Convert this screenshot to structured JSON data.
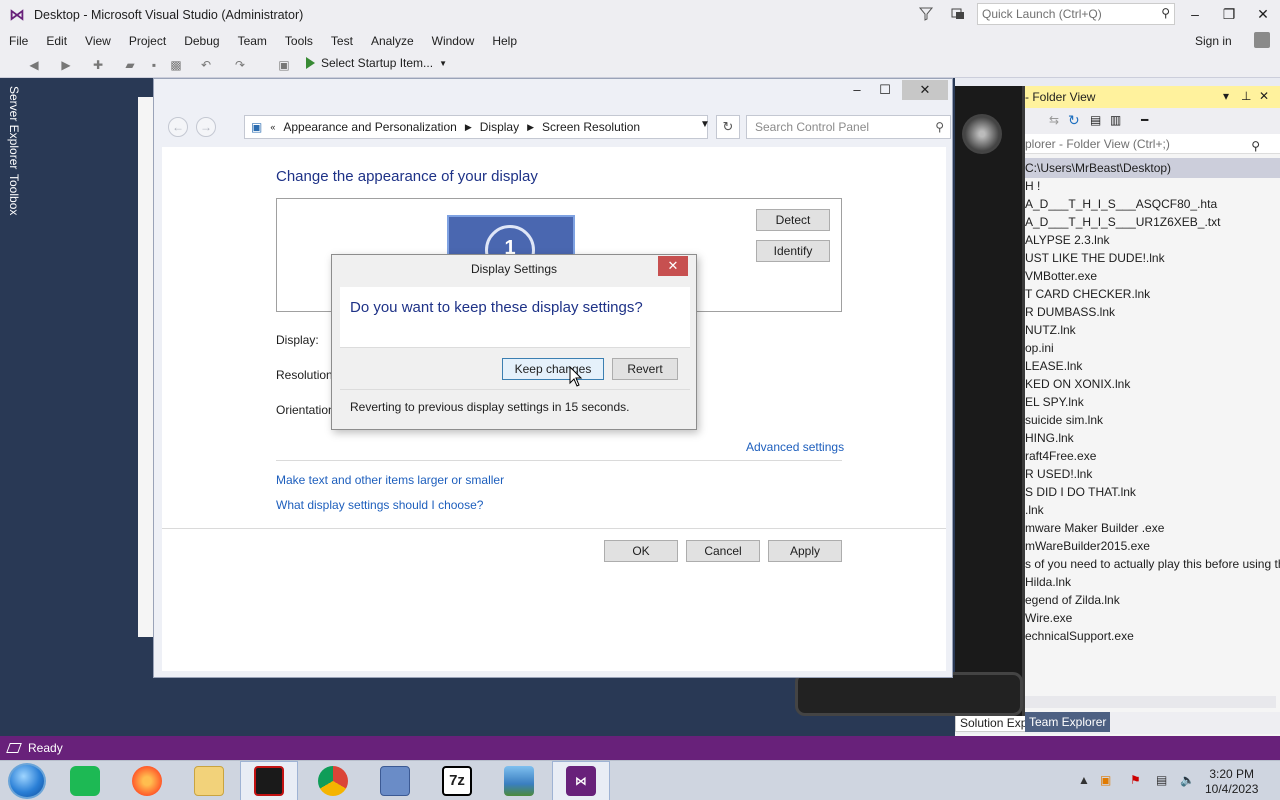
{
  "vs": {
    "title": "Desktop - Microsoft Visual Studio  (Administrator)",
    "quick_launch_placeholder": "Quick Launch (Ctrl+Q)",
    "menu": [
      "File",
      "Edit",
      "View",
      "Project",
      "Debug",
      "Team",
      "Tools",
      "Test",
      "Analyze",
      "Window",
      "Help"
    ],
    "sign_in": "Sign in",
    "start_item": "Select Startup Item...",
    "side_tabs": [
      "Server Explorer",
      "Toolbox"
    ],
    "status": "Ready",
    "brand_color": "#68217a"
  },
  "solution_explorer": {
    "header": "- Folder View",
    "search_placeholder": "plorer - Folder View (Ctrl+;)",
    "selected_path": "C:\\Users\\MrBeast\\Desktop)",
    "items": [
      "H !",
      "A_D___T_H_I_S___ASQCF80_.hta",
      "A_D___T_H_I_S___UR1Z6XEB_.txt",
      "ALYPSE 2.3.lnk",
      "UST LIKE THE DUDE!.lnk",
      "VMBotter.exe",
      "T CARD CHECKER.lnk",
      "R DUMBASS.lnk",
      "NUTZ.lnk",
      "op.ini",
      "LEASE.lnk",
      "KED ON XONIX.lnk",
      "EL SPY.lnk",
      " suicide sim.lnk",
      "HING.lnk",
      "raft4Free.exe",
      "R USED!.lnk",
      "S DID I DO THAT.lnk",
      ".lnk",
      "mware Maker Builder .exe",
      "mWareBuilder2015.exe",
      "s of you need to actually play this before using the v",
      " Hilda.lnk",
      "egend of Zilda.lnk",
      "Wire.exe",
      "echnicalSupport.exe"
    ],
    "tabs": [
      "Solution Explorer",
      "Team Explorer"
    ]
  },
  "control_panel": {
    "breadcrumb": [
      "Appearance and Personalization",
      "Display",
      "Screen Resolution"
    ],
    "search_placeholder": "Search Control Panel",
    "heading": "Change the appearance of your display",
    "monitor_number": "1",
    "detect": "Detect",
    "identify": "Identify",
    "display_label": "Display:",
    "resolution_label": "Resolution",
    "orientation_label": "Orientation",
    "advanced_link": "Advanced settings",
    "link_text_size": "Make text and other items larger or smaller",
    "link_help": "What display settings should I choose?",
    "ok": "OK",
    "cancel": "Cancel",
    "apply": "Apply"
  },
  "dialog": {
    "title": "Display Settings",
    "question": "Do you want to keep these display settings?",
    "keep": "Keep changes",
    "revert": "Revert",
    "footer": "Reverting to previous display settings in 15 seconds."
  },
  "taskbar": {
    "apps": [
      "spreadsheet",
      "firefox",
      "file-explorer",
      "red-app",
      "chrome",
      "keyboard-app",
      "7zip",
      "photo-viewer",
      "visual-studio"
    ],
    "seven_zip_label": "7z",
    "time": "3:20 PM",
    "date": "10/4/2023"
  }
}
